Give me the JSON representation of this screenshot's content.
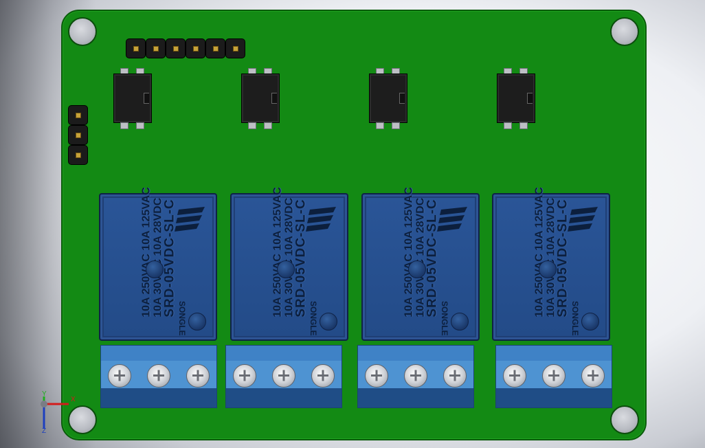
{
  "relays": [
    {
      "line1": "10A 250VAC 10A 125VAC",
      "line2": "10A 30VDC 10A 28VDC",
      "line3": "SRD-05VDC-SL-C",
      "brand": "SONGLE"
    },
    {
      "line1": "10A 250VAC 10A 125VAC",
      "line2": "10A 30VDC 10A 28VDC",
      "line3": "SRD-05VDC-SL-C",
      "brand": "SONGLE"
    },
    {
      "line1": "10A 250VAC 10A 125VAC",
      "line2": "10A 30VDC 10A 28VDC",
      "line3": "SRD-05VDC-SL-C",
      "brand": "SONGLE"
    },
    {
      "line1": "10A 250VAC 10A 125VAC",
      "line2": "10A 30VDC 10A 28VDC",
      "line3": "SRD-05VDC-SL-C",
      "brand": "SONGLE"
    }
  ],
  "axes": {
    "x": "X",
    "y": "Y",
    "z": "Z"
  },
  "colors": {
    "pcb": "#138a14",
    "relay": "#1f3f75",
    "terminal": "#4e93d2",
    "axis_x": "#d41b1b",
    "axis_y": "#1fae1f",
    "axis_z": "#1d3fbf"
  },
  "icons": [
    "mounting-hole-icon",
    "header-pin-icon",
    "optocoupler-icon",
    "relay-icon",
    "screw-terminal-icon",
    "axis-triad-icon"
  ]
}
